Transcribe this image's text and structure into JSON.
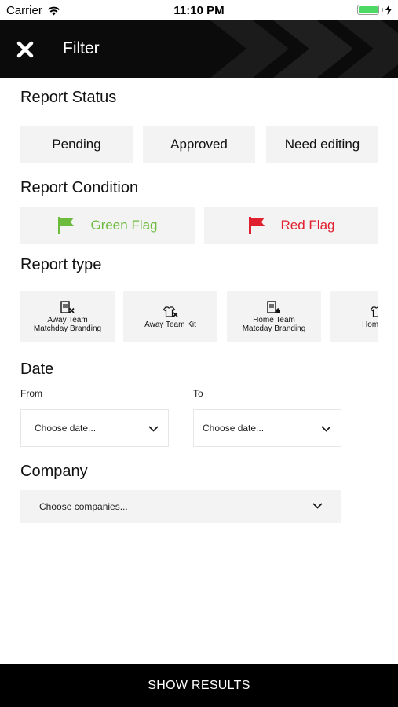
{
  "status_bar": {
    "carrier": "Carrier",
    "time": "11:10 PM",
    "battery_level": 1.0
  },
  "header": {
    "title": "Filter",
    "close_icon": "close-icon"
  },
  "report_status": {
    "title": "Report Status",
    "options": [
      "Pending",
      "Approved",
      "Need editing"
    ]
  },
  "report_condition": {
    "title": "Report Condition",
    "green": {
      "label": "Green Flag",
      "color": "#6cbb3c"
    },
    "red": {
      "label": "Red Flag",
      "color": "#e0202e"
    }
  },
  "report_type": {
    "title": "Report type",
    "items": [
      {
        "label": "Away Team\nMatchday Branding",
        "icon": "board-away-icon"
      },
      {
        "label": "Away Team Kit",
        "icon": "shirt-away-icon"
      },
      {
        "label": "Home Team\nMatcday Branding",
        "icon": "board-home-icon"
      },
      {
        "label": "Home Te",
        "icon": "shirt-home-icon"
      }
    ]
  },
  "date": {
    "title": "Date",
    "from_label": "From",
    "to_label": "To",
    "from_placeholder": "Choose date...",
    "to_placeholder": "Choose date..."
  },
  "company": {
    "title": "Company",
    "placeholder": "Choose companies..."
  },
  "footer": {
    "show_results": "SHOW RESULTS"
  }
}
